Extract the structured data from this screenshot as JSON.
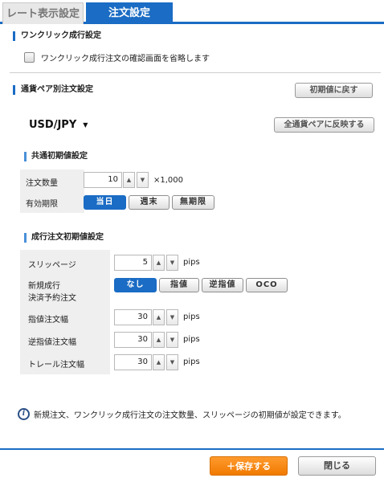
{
  "tabs": {
    "rate_display": "レート表示設定",
    "order_settings": "注文設定"
  },
  "one_click": {
    "title": "ワンクリック成行設定",
    "checkbox_label": "ワンクリック成行注文の確認画面を省略します",
    "checked": false
  },
  "pair_settings": {
    "title": "通貨ペア別注文設定",
    "reset_button": "初期値に戻す",
    "pair_value": "USD/JPY",
    "apply_all_button": "全通貨ペアに反映する"
  },
  "common": {
    "title": "共通初期値設定",
    "quantity_label": "注文数量",
    "quantity_value": "10",
    "quantity_multiplier": "×1,000",
    "expiry_label": "有効期限",
    "expiry_options": [
      "当日",
      "週末",
      "無期限"
    ],
    "expiry_selected": "当日"
  },
  "market": {
    "title": "成行注文初期値設定",
    "slippage_label": "スリッページ",
    "slippage_value": "5",
    "unit_pips": "pips",
    "new_settlement_label_1": "新規成行",
    "new_settlement_label_2": "決済予約注文",
    "settlement_options": [
      "なし",
      "指値",
      "逆指値",
      "OCO"
    ],
    "settlement_selected": "なし",
    "limit_width_label": "指値注文幅",
    "limit_width_value": "30",
    "stop_width_label": "逆指値注文幅",
    "stop_width_value": "30",
    "trail_width_label": "トレール注文幅",
    "trail_width_value": "30"
  },
  "info_text": "新規注文、ワンクリック成行注文の注文数量、スリッページの初期値が設定できます。",
  "footer": {
    "save": "＋保存する",
    "close": "閉じる"
  },
  "icons": {
    "spin_up": "▲",
    "spin_down": "▼",
    "info": "i",
    "caret": "▼"
  },
  "colors": {
    "accent": "#1a6cc4",
    "save": "#f07a00"
  }
}
